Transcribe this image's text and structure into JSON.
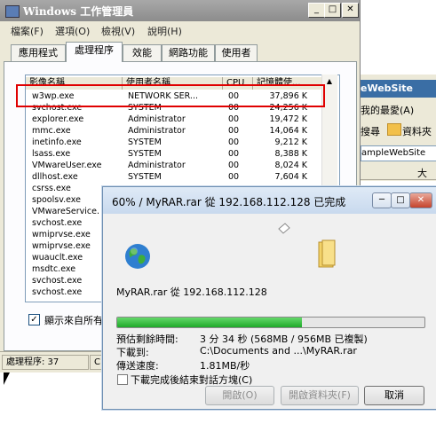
{
  "taskmgr": {
    "title": "Windows 工作管理員",
    "menu": [
      "檔案(F)",
      "選項(O)",
      "檢視(V)",
      "說明(H)"
    ],
    "tabs": [
      "應用程式",
      "處理程序",
      "效能",
      "網路功能",
      "使用者"
    ],
    "columns": [
      "影像名稱",
      "使用者名稱",
      "CPU",
      "記憶體使..."
    ],
    "processes": [
      {
        "name": "w3wp.exe",
        "user": "NETWORK SER...",
        "cpu": "00",
        "mem": "37,896 K"
      },
      {
        "name": "svchost.exe",
        "user": "SYSTEM",
        "cpu": "00",
        "mem": "24,256 K"
      },
      {
        "name": "explorer.exe",
        "user": "Administrator",
        "cpu": "00",
        "mem": "19,472 K"
      },
      {
        "name": "mmc.exe",
        "user": "Administrator",
        "cpu": "00",
        "mem": "14,064 K"
      },
      {
        "name": "inetinfo.exe",
        "user": "SYSTEM",
        "cpu": "00",
        "mem": "9,212 K"
      },
      {
        "name": "lsass.exe",
        "user": "SYSTEM",
        "cpu": "00",
        "mem": "8,388 K"
      },
      {
        "name": "VMwareUser.exe",
        "user": "Administrator",
        "cpu": "00",
        "mem": "8,024 K"
      },
      {
        "name": "dllhost.exe",
        "user": "SYSTEM",
        "cpu": "00",
        "mem": "7,604 K"
      },
      {
        "name": "csrss.exe",
        "user": "",
        "cpu": "",
        "mem": ""
      },
      {
        "name": "spoolsv.exe",
        "user": "",
        "cpu": "",
        "mem": ""
      },
      {
        "name": "VMwareService.",
        "user": "",
        "cpu": "",
        "mem": ""
      },
      {
        "name": "svchost.exe",
        "user": "",
        "cpu": "",
        "mem": ""
      },
      {
        "name": "wmiprvse.exe",
        "user": "",
        "cpu": "",
        "mem": ""
      },
      {
        "name": "wmiprvse.exe",
        "user": "",
        "cpu": "",
        "mem": ""
      },
      {
        "name": "wuauclt.exe",
        "user": "",
        "cpu": "",
        "mem": ""
      },
      {
        "name": "msdtc.exe",
        "user": "",
        "cpu": "",
        "mem": ""
      },
      {
        "name": "svchost.exe",
        "user": "",
        "cpu": "",
        "mem": ""
      },
      {
        "name": "svchost.exe",
        "user": "",
        "cpu": "",
        "mem": ""
      }
    ],
    "show_all_label": "顯示來自所有",
    "show_all_checked": "✓",
    "status_processes": "處理程序: 37",
    "status_cpu": "C"
  },
  "browser": {
    "title_fragment": "eWebSite",
    "favorites": "我的最愛(A)",
    "search": "搜尋",
    "folders": "資料夾",
    "address": "ampleWebSite",
    "col_big": "大"
  },
  "dialog": {
    "title": "60% / MyRAR.rar 從 192.168.112.128 已完成",
    "file_line": "MyRAR.rar 從 192.168.112.128",
    "progress": 0.6,
    "time_left_label": "預估剩餘時間:",
    "time_left_value": "3 分 34 秒 (568MB / 956MB 已複製)",
    "download_to_label": "下載到:",
    "download_to_value": "C:\\Documents and ...\\MyRAR.rar",
    "speed_label": "傳送速度:",
    "speed_value": "1.81MB/秒",
    "close_on_complete": "下載完成後結束對話方塊(C)",
    "btn_open": "開啟(O)",
    "btn_open_folder": "開啟資料夾(F)",
    "btn_cancel": "取消",
    "btn_minimize": "─",
    "btn_maximize": "□",
    "btn_close": "✕"
  },
  "colors": {
    "highlight_box": "#e00000",
    "progress_green": "#1faa2a"
  }
}
